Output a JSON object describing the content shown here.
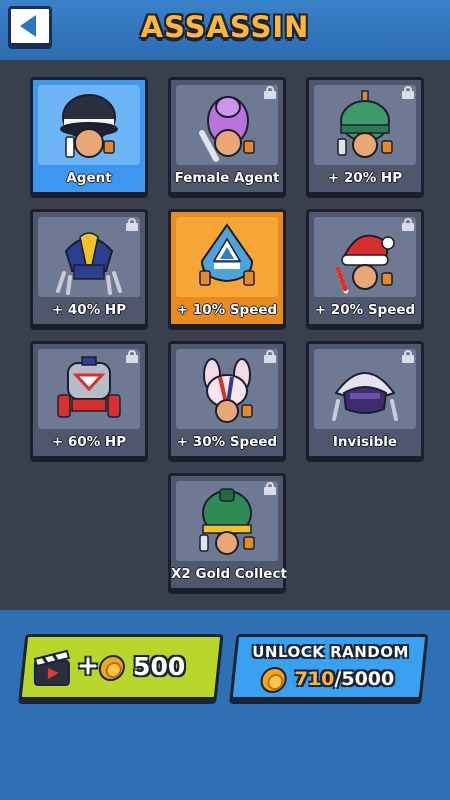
{
  "header": {
    "title": "ASSASSIN",
    "back_icon": "back-arrow-icon"
  },
  "skins": [
    {
      "label": "Agent",
      "state": "selected",
      "locked": false,
      "icon": "agent-fedora-character"
    },
    {
      "label": "Female Agent",
      "state": "normal",
      "locked": true,
      "icon": "female-agent-character"
    },
    {
      "label": "+ 20% HP",
      "state": "normal",
      "locked": true,
      "icon": "bomb-helmet-character"
    },
    {
      "label": "+ 40% HP",
      "state": "normal",
      "locked": true,
      "icon": "visor-robot-character"
    },
    {
      "label": "+ 10% Speed",
      "state": "active",
      "locked": false,
      "icon": "blue-hood-character"
    },
    {
      "label": "+ 20% Speed",
      "state": "normal",
      "locked": true,
      "icon": "santa-hat-character"
    },
    {
      "label": "+ 60% HP",
      "state": "normal",
      "locked": true,
      "icon": "mech-robot-character"
    },
    {
      "label": "+ 30% Speed",
      "state": "normal",
      "locked": true,
      "icon": "bunny-character"
    },
    {
      "label": "Invisible",
      "state": "normal",
      "locked": true,
      "icon": "purple-ninja-character"
    },
    {
      "label": "X2 Gold Collect",
      "state": "normal",
      "locked": true,
      "icon": "green-cap-character"
    }
  ],
  "video_reward": {
    "plus": "+",
    "amount": "500",
    "icon": "video-clapper-icon"
  },
  "unlock_random": {
    "label": "UNLOCK RANDOM",
    "current": "710",
    "separator": "/",
    "total": "5000"
  },
  "colors": {
    "selected": "#3d97f0",
    "active": "#e88a1e",
    "normal": "#4e576b",
    "video_button": "#b9d62b",
    "unlock_button": "#3aa0f0",
    "title": "#ffb63b",
    "coin_current": "#ffb63b"
  }
}
